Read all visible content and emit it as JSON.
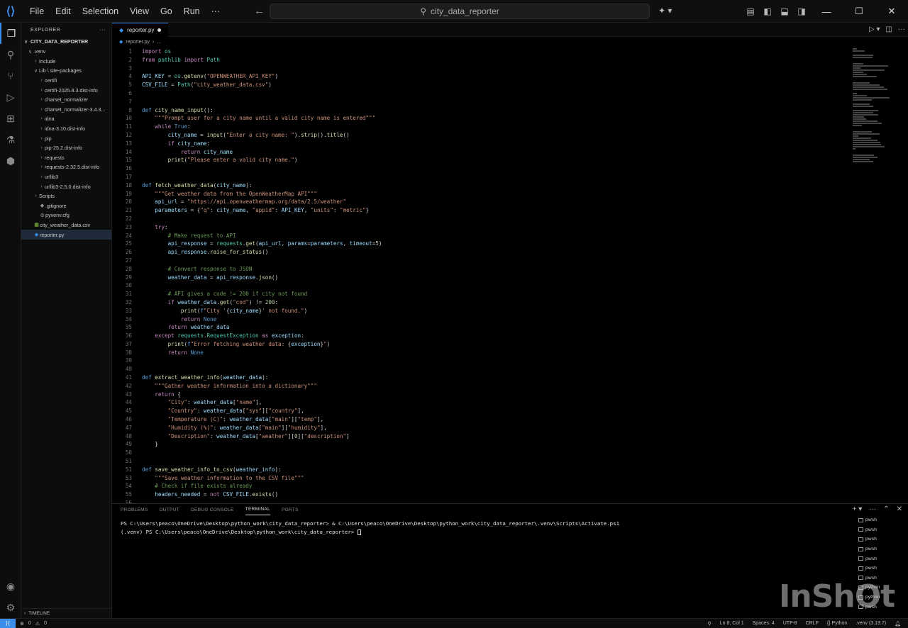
{
  "window": {
    "search_text": "city_data_reporter"
  },
  "menu": [
    "File",
    "Edit",
    "Selection",
    "View",
    "Go",
    "Run",
    "···"
  ],
  "sidebar": {
    "header": "EXPLORER",
    "project": "CITY_DATA_REPORTER",
    "items": [
      {
        "label": ".venv",
        "chev": "∨",
        "indent": 1,
        "icon": ""
      },
      {
        "label": "Include",
        "chev": "›",
        "indent": 2,
        "icon": ""
      },
      {
        "label": "Lib \\ site-packages",
        "chev": "∨",
        "indent": 2,
        "icon": ""
      },
      {
        "label": "certifi",
        "chev": "›",
        "indent": 3,
        "icon": ""
      },
      {
        "label": "certifi-2025.8.3.dist-info",
        "chev": "›",
        "indent": 3,
        "icon": ""
      },
      {
        "label": "charset_normalizer",
        "chev": "›",
        "indent": 3,
        "icon": ""
      },
      {
        "label": "charset_normalizer-3.4.3...",
        "chev": "›",
        "indent": 3,
        "icon": ""
      },
      {
        "label": "idna",
        "chev": "›",
        "indent": 3,
        "icon": ""
      },
      {
        "label": "idna-3.10.dist-info",
        "chev": "›",
        "indent": 3,
        "icon": ""
      },
      {
        "label": "pip",
        "chev": "›",
        "indent": 3,
        "icon": ""
      },
      {
        "label": "pip-25.2.dist-info",
        "chev": "›",
        "indent": 3,
        "icon": ""
      },
      {
        "label": "requests",
        "chev": "›",
        "indent": 3,
        "icon": ""
      },
      {
        "label": "requests-2.32.5.dist-info",
        "chev": "›",
        "indent": 3,
        "icon": ""
      },
      {
        "label": "urllib3",
        "chev": "›",
        "indent": 3,
        "icon": ""
      },
      {
        "label": "urllib3-2.5.0.dist-info",
        "chev": "›",
        "indent": 3,
        "icon": ""
      },
      {
        "label": "Scripts",
        "chev": "›",
        "indent": 2,
        "icon": ""
      },
      {
        "label": ".gitignore",
        "chev": "",
        "indent": 2,
        "icon": "◆"
      },
      {
        "label": "pyvenv.cfg",
        "chev": "",
        "indent": 2,
        "icon": "⚙"
      },
      {
        "label": "city_weather_data.csv",
        "chev": "",
        "indent": 1,
        "icon": "▦"
      },
      {
        "label": "reporter.py",
        "chev": "",
        "indent": 1,
        "icon": "◆",
        "selected": true
      }
    ],
    "timeline": "TIMELINE"
  },
  "editor": {
    "tab_label": "reporter.py",
    "breadcrumb": [
      "reporter.py",
      "..."
    ]
  },
  "code": [
    {
      "n": "1",
      "h": "<span class='kw'>import</span> <span class='cls'>os</span>"
    },
    {
      "n": "2",
      "h": "<span class='kw'>from</span> <span class='cls'>pathlib</span> <span class='kw'>import</span> <span class='cls'>Path</span>"
    },
    {
      "n": "3",
      "h": ""
    },
    {
      "n": "4",
      "h": "<span class='var'>API_KEY</span> = <span class='cls'>os</span>.<span class='fn'>getenv</span>(<span class='str'>\"OPENWEATHER_API_KEY\"</span>)"
    },
    {
      "n": "5",
      "h": "<span class='var'>CSV_FILE</span> = <span class='cls'>Path</span>(<span class='str'>\"city_weather_data.csv\"</span>)"
    },
    {
      "n": "6",
      "h": ""
    },
    {
      "n": "7",
      "h": ""
    },
    {
      "n": "8",
      "h": "<span class='kw2'>def</span> <span class='fn'>city_name_input</span>():"
    },
    {
      "n": "10",
      "h": "    <span class='str'>\"\"\"Prompt user for a city name until a valid city name is entered\"\"\"</span>"
    },
    {
      "n": "11",
      "h": "    <span class='kw'>while</span> <span class='kw2'>True</span>:"
    },
    {
      "n": "12",
      "h": "        <span class='var'>city_name</span> = <span class='fn'>input</span>(<span class='str'>\"Enter a city name: \"</span>).<span class='fn'>strip</span>().<span class='fn'>title</span>()"
    },
    {
      "n": "13",
      "h": "        <span class='kw'>if</span> <span class='var'>city_name</span>:"
    },
    {
      "n": "14",
      "h": "            <span class='kw'>return</span> <span class='var'>city_name</span>"
    },
    {
      "n": "15",
      "h": "        <span class='fn'>print</span>(<span class='str'>\"Please enter a valid city name.\"</span>)"
    },
    {
      "n": "16",
      "h": ""
    },
    {
      "n": "17",
      "h": ""
    },
    {
      "n": "18",
      "h": "<span class='kw2'>def</span> <span class='fn'>fetch_weather_data</span>(<span class='var'>city_name</span>):"
    },
    {
      "n": "19",
      "h": "    <span class='str'>\"\"\"Get weather data from the OpenWeatherMap API\"\"\"</span>"
    },
    {
      "n": "20",
      "h": "    <span class='var'>api_url</span> = <span class='str'>\"https://api.openweathermap.org/data/2.5/weather\"</span>"
    },
    {
      "n": "21",
      "h": "    <span class='var'>parameters</span> = {<span class='str'>\"q\"</span>: <span class='var'>city_name</span>, <span class='str'>\"appid\"</span>: <span class='var'>API_KEY</span>, <span class='str'>\"units\"</span>: <span class='str'>\"metric\"</span>}"
    },
    {
      "n": "22",
      "h": ""
    },
    {
      "n": "23",
      "h": "    <span class='kw'>try</span>:"
    },
    {
      "n": "24",
      "h": "        <span class='cmt'># Make request to API</span>"
    },
    {
      "n": "25",
      "h": "        <span class='var'>api_response</span> = <span class='cls'>requests</span>.<span class='fn'>get</span>(<span class='var'>api_url</span>, <span class='var'>params</span>=<span class='var'>parameters</span>, <span class='var'>timeout</span>=<span class='num'>5</span>)"
    },
    {
      "n": "26",
      "h": "        <span class='var'>api_response</span>.<span class='fn'>raise_for_status</span>()"
    },
    {
      "n": "27",
      "h": ""
    },
    {
      "n": "28",
      "h": "        <span class='cmt'># Convert response to JSON</span>"
    },
    {
      "n": "29",
      "h": "        <span class='var'>weather_data</span> = <span class='var'>api_response</span>.<span class='fn'>json</span>()"
    },
    {
      "n": "30",
      "h": ""
    },
    {
      "n": "31",
      "h": "        <span class='cmt'># API gives a code != 200 if city not found</span>"
    },
    {
      "n": "32",
      "h": "        <span class='kw'>if</span> <span class='var'>weather_data</span>.<span class='fn'>get</span>(<span class='str'>\"cod\"</span>) != <span class='num'>200</span>:"
    },
    {
      "n": "33",
      "h": "            <span class='fn'>print</span>(<span class='kw2'>f</span><span class='str'>\"City '</span>{<span class='var'>city_name</span>}<span class='str'>' not found.\"</span>)"
    },
    {
      "n": "34",
      "h": "            <span class='kw'>return</span> <span class='kw2'>None</span>"
    },
    {
      "n": "35",
      "h": "        <span class='kw'>return</span> <span class='var'>weather_data</span>"
    },
    {
      "n": "36",
      "h": "    <span class='kw'>except</span> <span class='cls'>requests</span>.<span class='cls'>RequestException</span> <span class='kw'>as</span> <span class='var'>exception</span>:"
    },
    {
      "n": "37",
      "h": "        <span class='fn'>print</span>(<span class='kw2'>f</span><span class='str'>\"Error fetching weather data: </span>{<span class='var'>exception</span>}<span class='str'>\"</span>)"
    },
    {
      "n": "38",
      "h": "        <span class='kw'>return</span> <span class='kw2'>None</span>"
    },
    {
      "n": "39",
      "h": ""
    },
    {
      "n": "40",
      "h": ""
    },
    {
      "n": "41",
      "h": "<span class='kw2'>def</span> <span class='fn'>extract_weather_info</span>(<span class='var'>weather_data</span>):"
    },
    {
      "n": "42",
      "h": "    <span class='str'>\"\"\"Gather weather information into a dictionary\"\"\"</span>"
    },
    {
      "n": "43",
      "h": "    <span class='kw'>return</span> {"
    },
    {
      "n": "44",
      "h": "        <span class='str'>\"City\"</span>: <span class='var'>weather_data</span>[<span class='str'>\"name\"</span>],"
    },
    {
      "n": "45",
      "h": "        <span class='str'>\"Country\"</span>: <span class='var'>weather_data</span>[<span class='str'>\"sys\"</span>][<span class='str'>\"country\"</span>],"
    },
    {
      "n": "46",
      "h": "        <span class='str'>\"Temperature (C)\"</span>: <span class='var'>weather_data</span>[<span class='str'>\"main\"</span>][<span class='str'>\"temp\"</span>],"
    },
    {
      "n": "47",
      "h": "        <span class='str'>\"Humidity (%)\"</span>: <span class='var'>weather_data</span>[<span class='str'>\"main\"</span>][<span class='str'>\"humidity\"</span>],"
    },
    {
      "n": "48",
      "h": "        <span class='str'>\"Description\"</span>: <span class='var'>weather_data</span>[<span class='str'>\"weather\"</span>][<span class='num'>0</span>][<span class='str'>\"description\"</span>]"
    },
    {
      "n": "49",
      "h": "    }"
    },
    {
      "n": "50",
      "h": ""
    },
    {
      "n": "51",
      "h": ""
    },
    {
      "n": "51",
      "h": "<span class='kw2'>def</span> <span class='fn'>save_weather_info_to_csv</span>(<span class='var'>weather_info</span>):"
    },
    {
      "n": "53",
      "h": "    <span class='str'>\"\"\"Save weather information to the CSV file\"\"\"</span>"
    },
    {
      "n": "54",
      "h": "    <span class='cmt'># Check if file exists already</span>"
    },
    {
      "n": "55",
      "h": "    <span class='var'>headers_needed</span> = <span class='kw'>not</span> <span class='var'>CSV_FILE</span>.<span class='fn'>exists</span>()"
    },
    {
      "n": "56",
      "h": ""
    }
  ],
  "panel": {
    "tabs": [
      "PROBLEMS",
      "OUTPUT",
      "DEBUG CONSOLE",
      "TERMINAL",
      "PORTS"
    ],
    "active_tab": "TERMINAL",
    "terminal_lines": [
      "PS C:\\Users\\peaco\\OneDrive\\Desktop\\python_work\\city_data_reporter> & C:\\Users\\peaco\\OneDrive\\Desktop\\python_work\\city_data_reporter\\.venv\\Scripts\\Activate.ps1",
      "(.venv) PS C:\\Users\\peaco\\OneDrive\\Desktop\\python_work\\city_data_reporter> "
    ],
    "terminal_instances": [
      "pwsh",
      "pwsh",
      "pwsh",
      "pwsh",
      "pwsh",
      "pwsh",
      "pwsh",
      "python",
      "python",
      "pwsh"
    ]
  },
  "watermark": "InShOt",
  "statusbar": {
    "errors": "0",
    "warnings": "0",
    "position": "Ln 8, Col 1",
    "spaces": "Spaces: 4",
    "encoding": "UTF-8",
    "eol": "CRLF",
    "language": "Python",
    "interpreter": ".venv (3.13.7)"
  },
  "colors": {
    "accent": "#3b8eea"
  }
}
